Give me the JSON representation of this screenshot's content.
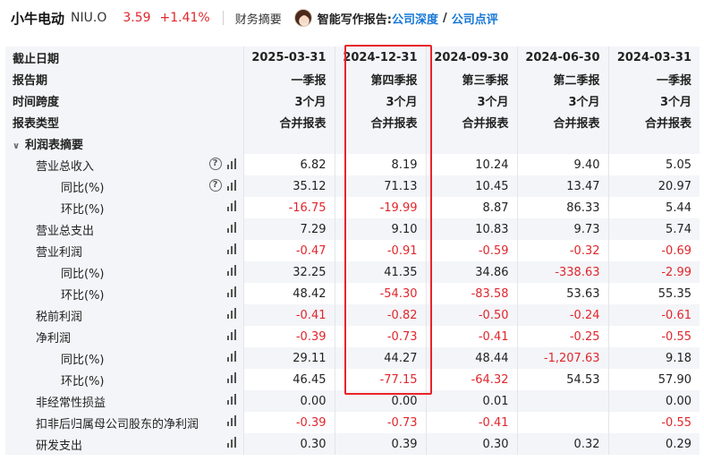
{
  "header": {
    "stock_name": "小牛电动",
    "stock_code": "NIU.O",
    "price": "3.59",
    "change": "+1.41%",
    "financial_summary": "财务摘要",
    "ai_report_label": "智能写作报告:",
    "link_company_depth": "公司深度",
    "slash": "/",
    "link_company_review": "公司点评",
    "accent_color": "#e0262c",
    "link_color": "#1677d6"
  },
  "table": {
    "header_rows": [
      {
        "label": "截止日期",
        "values": [
          "2025-03-31",
          "2024-12-31",
          "2024-09-30",
          "2024-06-30",
          "2024-03-31"
        ]
      },
      {
        "label": "报告期",
        "values": [
          "一季报",
          "第四季报",
          "第三季报",
          "第二季报",
          "一季报"
        ]
      },
      {
        "label": "时间跨度",
        "values": [
          "3个月",
          "3个月",
          "3个月",
          "3个月",
          "3个月"
        ]
      },
      {
        "label": "报表类型",
        "values": [
          "合并报表",
          "合并报表",
          "合并报表",
          "合并报表",
          "合并报表"
        ]
      }
    ],
    "section_title": "利润表摘要",
    "rows": [
      {
        "label": "营业总收入",
        "values": [
          "6.82",
          "8.19",
          "10.24",
          "9.40",
          "5.05"
        ]
      },
      {
        "label": "同比(%)",
        "values": [
          "35.12",
          "71.13",
          "10.45",
          "13.47",
          "20.97"
        ]
      },
      {
        "label": "环比(%)",
        "values": [
          "-16.75",
          "-19.99",
          "8.87",
          "86.33",
          "5.44"
        ]
      },
      {
        "label": "营业总支出",
        "values": [
          "7.29",
          "9.10",
          "10.83",
          "9.73",
          "5.74"
        ]
      },
      {
        "label": "营业利润",
        "values": [
          "-0.47",
          "-0.91",
          "-0.59",
          "-0.32",
          "-0.69"
        ]
      },
      {
        "label": "同比(%)",
        "values": [
          "32.25",
          "41.35",
          "34.86",
          "-338.63",
          "-2.99"
        ]
      },
      {
        "label": "环比(%)",
        "values": [
          "48.42",
          "-54.30",
          "-83.58",
          "53.63",
          "55.35"
        ]
      },
      {
        "label": "税前利润",
        "values": [
          "-0.41",
          "-0.82",
          "-0.50",
          "-0.24",
          "-0.61"
        ]
      },
      {
        "label": "净利润",
        "values": [
          "-0.39",
          "-0.73",
          "-0.41",
          "-0.25",
          "-0.55"
        ]
      },
      {
        "label": "同比(%)",
        "values": [
          "29.11",
          "44.27",
          "48.44",
          "-1,207.63",
          "9.18"
        ]
      },
      {
        "label": "环比(%)",
        "values": [
          "46.45",
          "-77.15",
          "-64.32",
          "54.53",
          "57.90"
        ]
      },
      {
        "label": "非经常性损益",
        "values": [
          "0.00",
          "0.00",
          "0.01",
          "",
          "0.00"
        ]
      },
      {
        "label": "扣非后归属母公司股东的净利润",
        "values": [
          "-0.39",
          "-0.73",
          "-0.41",
          "",
          "-0.55"
        ]
      },
      {
        "label": "研发支出",
        "values": [
          "0.30",
          "0.39",
          "0.30",
          "0.32",
          "0.29"
        ]
      }
    ]
  }
}
